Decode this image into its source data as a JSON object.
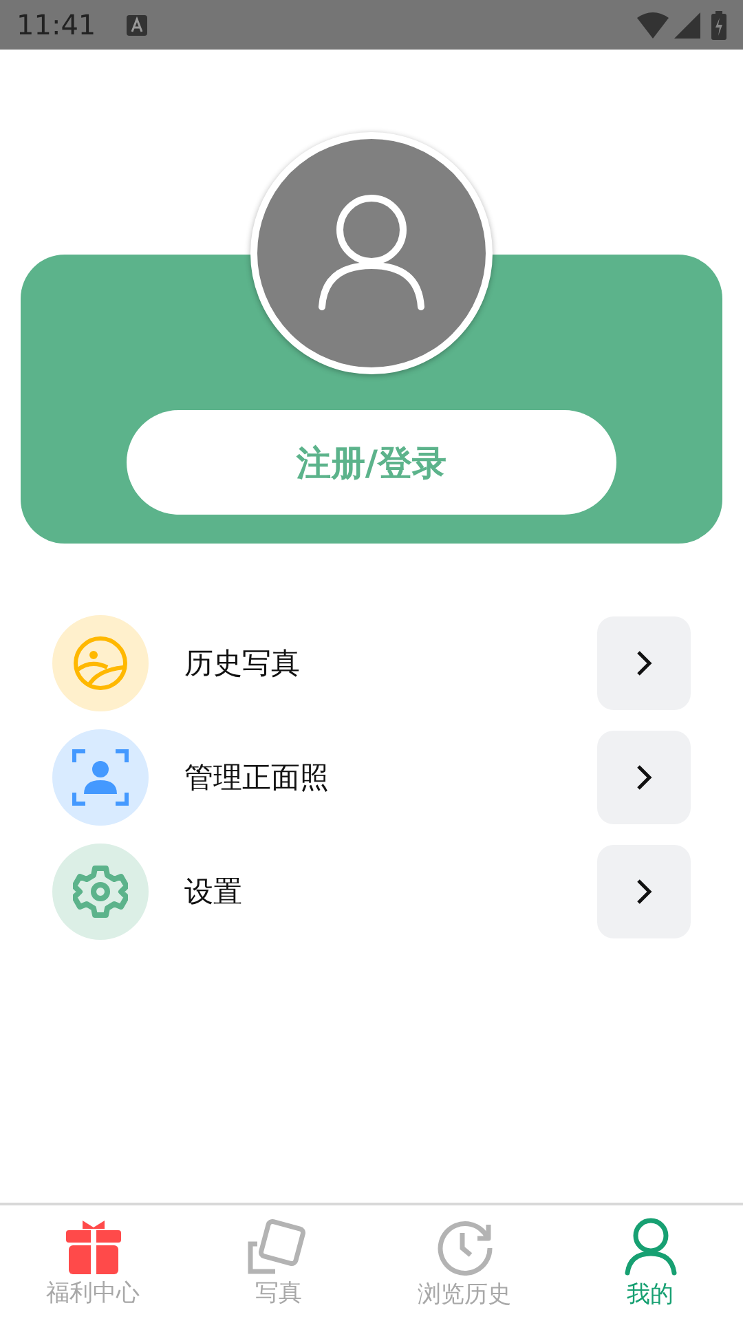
{
  "status_bar": {
    "time": "11:41"
  },
  "profile": {
    "login_button": "注册/登录"
  },
  "menu": [
    {
      "kind": "photo",
      "label": "历史写真"
    },
    {
      "kind": "face",
      "label": "管理正面照"
    },
    {
      "kind": "settings",
      "label": "设置"
    }
  ],
  "tabs": [
    {
      "kind": "gift",
      "label": "福利中心",
      "selected": false
    },
    {
      "kind": "photos",
      "label": "写真",
      "selected": false
    },
    {
      "kind": "history",
      "label": "浏览历史",
      "selected": false
    },
    {
      "kind": "me",
      "label": "我的",
      "selected": true
    }
  ]
}
